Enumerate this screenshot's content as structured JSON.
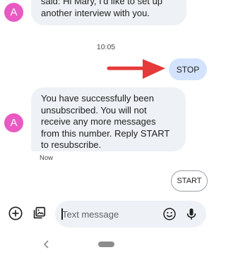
{
  "messages": {
    "top_fragment": "said: Hi Mary, I'd like to set up another interview with you.",
    "timestamp": "10:05",
    "sent_text": "STOP",
    "unsubscribe_text": "You have successfully been unsubscribed. You will not receive any more messages from this number. Reply START to resubscribe.",
    "received_time": "Now"
  },
  "avatar_letter": "A",
  "suggestion": {
    "label": "START"
  },
  "compose": {
    "placeholder": "Text message"
  },
  "icons": {
    "add": "add-circle-icon",
    "media": "gallery-icon",
    "emoji": "emoji-icon",
    "mic": "mic-icon",
    "back": "back-chevron-icon",
    "home": "home-pill-icon",
    "annotation": "red-arrow-icon"
  },
  "colors": {
    "avatar": "#e85ac2",
    "sent_bubble": "#d3e3fd",
    "received_bubble": "#eef1f5",
    "arrow": "#e5393a"
  }
}
